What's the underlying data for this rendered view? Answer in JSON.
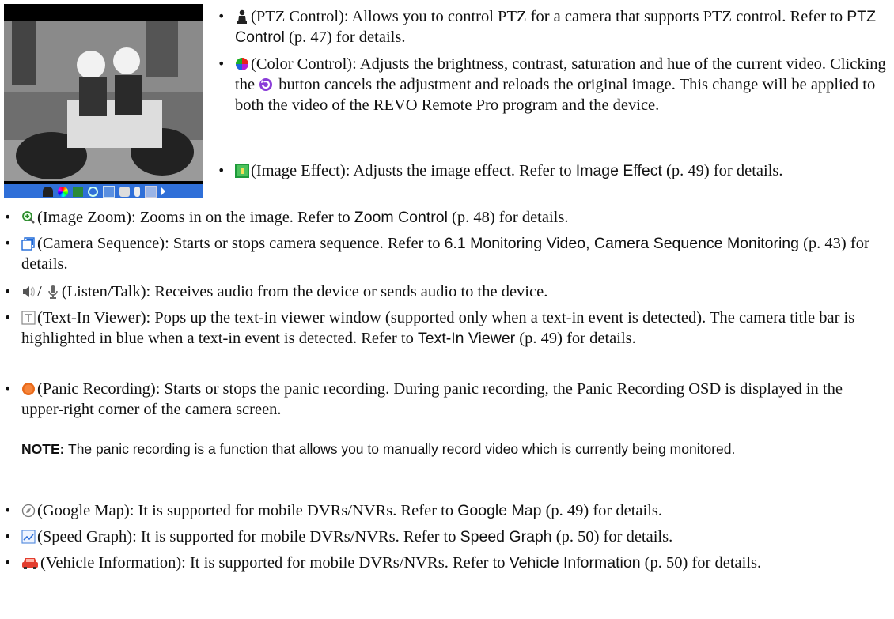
{
  "items": [
    {
      "icon": "person-icon",
      "label": "(PTZ Control): Allows you to control PTZ for a camera that supports PTZ control.  Refer to ",
      "ref": "PTZ Control",
      "after": " (p. 47) for details."
    },
    {
      "icon": "color-wheel-icon",
      "label": "(Color Control): Adjusts the brightness, contrast, saturation and hue of the current video.  Clicking the ",
      "mid_icon": "reset-icon",
      "label2": " button cancels the adjustment and reloads the original image.  This change will be applied to both the video of the REVO Remote Pro program and the device."
    },
    {
      "icon": "image-effect-icon",
      "label": "(Image Effect): Adjusts the image effect.  Refer to ",
      "ref": "Image Effect",
      "after": " (p. 49) for details."
    },
    {
      "icon": "zoom-icon",
      "label": "(Image Zoom): Zooms in on the image.  Refer to ",
      "ref": "Zoom Control",
      "after": " (p. 48) for details."
    },
    {
      "icon": "camera-sequence-icon",
      "label": "(Camera Sequence): Starts or stops camera sequence.  Refer to ",
      "ref": "6.1 Monitoring Video, Camera Sequence Monitoring",
      "after": " (p. 43) for details."
    },
    {
      "icon": "speaker-icon",
      "sep": "/",
      "icon2": "microphone-icon",
      "label": "(Listen/Talk): Receives audio from the device or sends audio to the device."
    },
    {
      "icon": "text-in-icon",
      "label": "(Text-In Viewer): Pops up the text-in viewer window (supported only when a text-in event is detected). The camera title bar is highlighted in blue when a text-in event is detected.  Refer to ",
      "ref": "Text-In Viewer",
      "after": " (p. 49) for details."
    },
    {
      "icon": "record-icon",
      "label": "(Panic Recording): Starts or stops the panic recording.  During panic recording, the Panic Recording OSD is displayed in the upper-right corner of the camera screen."
    },
    {
      "icon": "compass-icon",
      "label": "(Google Map): It is supported for mobile DVRs/NVRs.  Refer to ",
      "ref": "Google Map",
      "after": " (p. 49) for details."
    },
    {
      "icon": "graph-icon",
      "label": "(Speed Graph): It is supported for mobile DVRs/NVRs.  Refer to ",
      "ref": "Speed Graph",
      "after": " (p. 50) for details."
    },
    {
      "icon": "car-icon",
      "label": "(Vehicle Information): It is supported for mobile DVRs/NVRs.  Refer to ",
      "ref": "Vehicle Information",
      "after": " (p. 50) for details."
    }
  ],
  "note": {
    "prefix": "NOTE:",
    "text": " The panic recording is a function that allows you to manually record video which is currently being monitored."
  }
}
